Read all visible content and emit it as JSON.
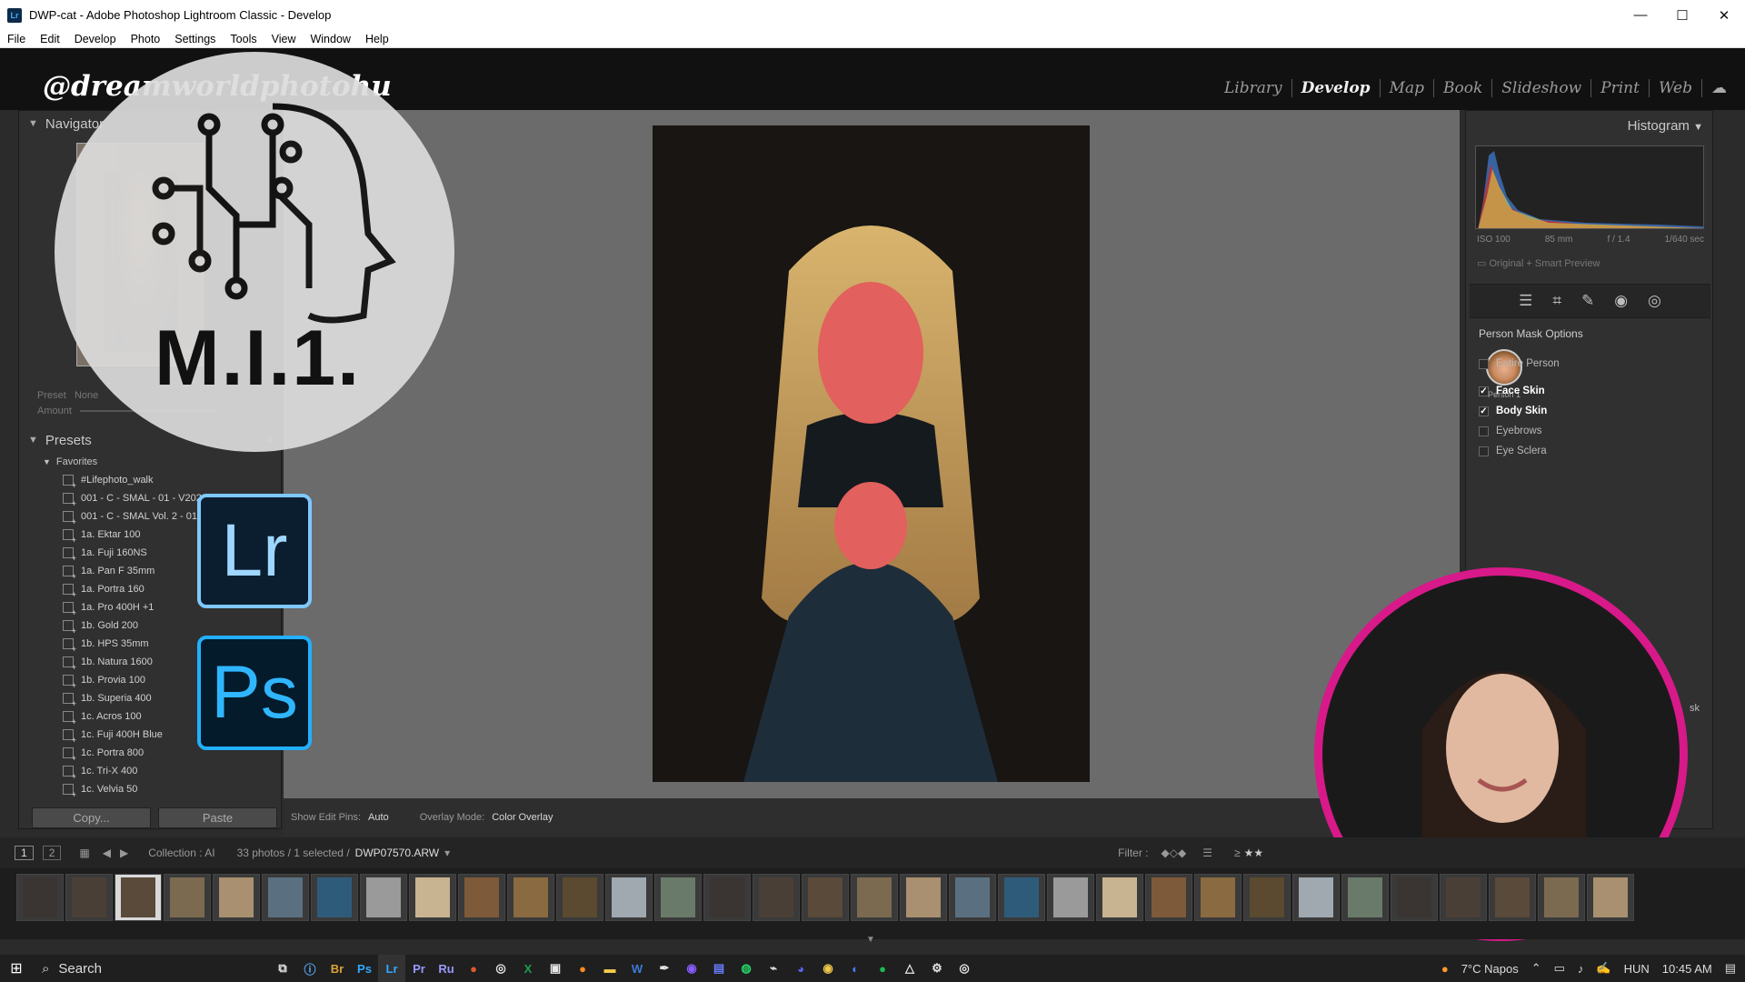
{
  "window": {
    "title": "DWP-cat - Adobe Photoshop Lightroom Classic - Develop",
    "controls": [
      "—",
      "☐",
      "✕"
    ]
  },
  "menu": [
    "File",
    "Edit",
    "Develop",
    "Photo",
    "Settings",
    "Tools",
    "View",
    "Window",
    "Help"
  ],
  "overlay": {
    "handle": "@dreamworldphotohu",
    "logo_text": "M.I.1.",
    "lr_tile": "Lr",
    "ps_tile": "Ps"
  },
  "modules": {
    "items": [
      "Library",
      "Develop",
      "Map",
      "Book",
      "Slideshow",
      "Print",
      "Web"
    ],
    "active": "Develop"
  },
  "left_panel": {
    "navigator_title": "Navigator",
    "preset_label": "Preset",
    "preset_value": "None",
    "amount_label": "Amount",
    "presets_title": "Presets",
    "presets_add": "+",
    "favorites_label": "Favorites",
    "presets": [
      "#Lifephoto_walk",
      "001 - C - SMAL - 01 - V202",
      "001 - C - SMAL Vol. 2 - 01",
      "1a. Ektar 100",
      "1a. Fuji 160NS",
      "1a. Pan F 35mm",
      "1a. Portra 160",
      "1a. Pro 400H +1",
      "1b. Gold 200",
      "1b. HPS 35mm",
      "1b. Natura 1600",
      "1b. Provia 100",
      "1b. Superia 400",
      "1c. Acros 100",
      "1c. Fuji 400H Blue",
      "1c. Portra 800",
      "1c. Tri-X 400",
      "1c. Velvia 50"
    ],
    "copy_label": "Copy...",
    "paste_label": "Paste"
  },
  "toolbar": {
    "edit_pins_label": "Show Edit Pins:",
    "edit_pins_value": "Auto",
    "overlay_mode_label": "Overlay Mode:",
    "overlay_mode_value": "Color Overlay"
  },
  "right_panel": {
    "histogram_title": "Histogram",
    "iso": "ISO 100",
    "focal": "85 mm",
    "aperture": "f / 1.4",
    "shutter": "1/640 sec",
    "preview_label": "Original + Smart Preview",
    "mask_options_title": "Person Mask Options",
    "person_label": "Person 1",
    "mask_parts": [
      {
        "label": "Entire Person",
        "checked": false
      },
      {
        "label": "Face Skin",
        "checked": true
      },
      {
        "label": "Body Skin",
        "checked": true
      },
      {
        "label": "Eyebrows",
        "checked": false
      },
      {
        "label": "Eye Sclera",
        "checked": false
      }
    ],
    "partial_label": "sk"
  },
  "filmstrip": {
    "page1": "1",
    "page2": "2",
    "collection": "Collection : AI",
    "count": "33 photos / 1 selected /",
    "filename": "DWP07570.ARW",
    "filter_label": "Filter :",
    "rating_op": "≥",
    "thumbnail_count": 33
  },
  "taskbar": {
    "search_placeholder": "Search",
    "weather": "7°C  Napos",
    "language": "HUN",
    "time": "10:45 AM"
  },
  "colors": {
    "accent_ring": "#d8198a",
    "panel_bg": "#303030",
    "canvas_bg": "#6b6b6b"
  }
}
